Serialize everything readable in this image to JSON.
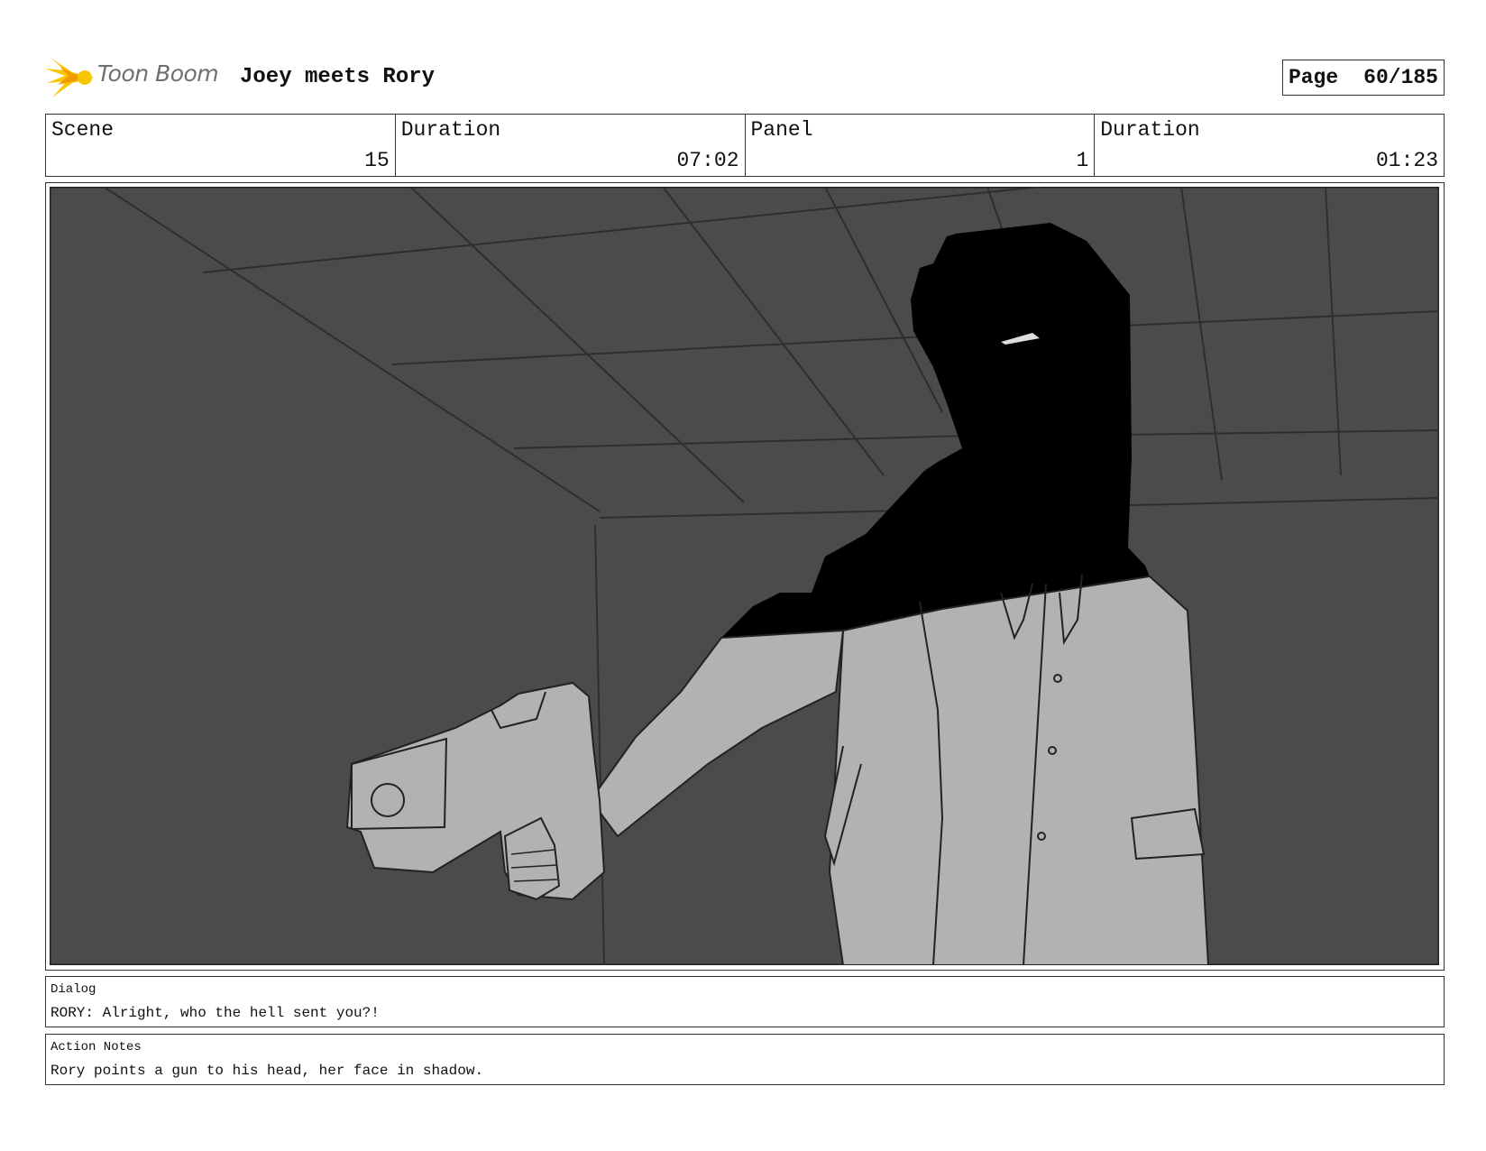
{
  "header": {
    "logo_text": "Toon Boom",
    "project_title": "Joey meets Rory",
    "page_label": "Page",
    "page_value": "60/185"
  },
  "info": [
    {
      "label": "Scene",
      "value": "15"
    },
    {
      "label": "Duration",
      "value": "07:02"
    },
    {
      "label": "Panel",
      "value": "1"
    },
    {
      "label": "Duration",
      "value": "01:23"
    }
  ],
  "panel": {
    "description_icon": "storyboard-sketch",
    "colors": {
      "background": "#4b4b4b",
      "shadow": "#000000",
      "figure": "#b2b2b2"
    }
  },
  "dialog": {
    "label": "Dialog",
    "text": "RORY: Alright, who the hell sent you?!"
  },
  "action_notes": {
    "label": "Action Notes",
    "text": "Rory points a gun to his head, her face in shadow."
  },
  "colors": {
    "logo_yellow": "#f7c600",
    "logo_orange": "#f29a00",
    "border": "#333333"
  }
}
